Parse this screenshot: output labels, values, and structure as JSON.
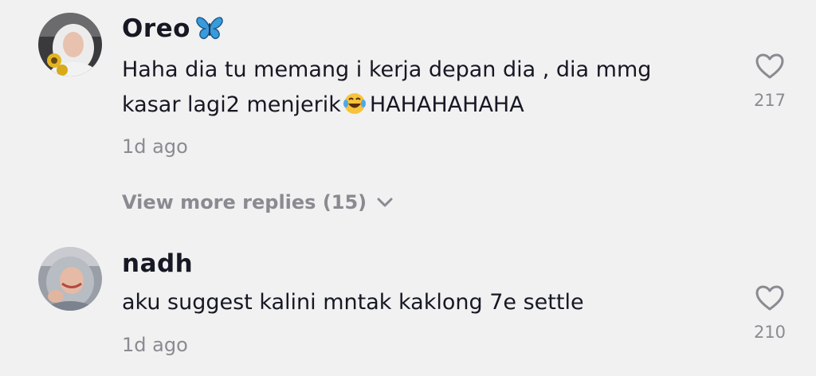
{
  "comments": [
    {
      "username": "Oreo",
      "badge": "butterfly-emoji",
      "text_before_emoji": "Haha dia tu memang i kerja depan dia , dia mmg kasar lagi2 menjerik",
      "inline_emoji": "face-with-tears-of-joy-emoji",
      "text_after_emoji": "HAHAHAHAHA",
      "time": "1d ago",
      "likes": "217"
    },
    {
      "username": "nadh",
      "text": "aku suggest kalini mntak kaklong 7e settle",
      "time": "1d ago",
      "likes": "210"
    }
  ],
  "replies": {
    "label": "View more replies (15)",
    "icon": "chevron-down-icon"
  },
  "colors": {
    "background": "#f1f1f2",
    "text": "#161823",
    "muted": "#8a8b91"
  }
}
